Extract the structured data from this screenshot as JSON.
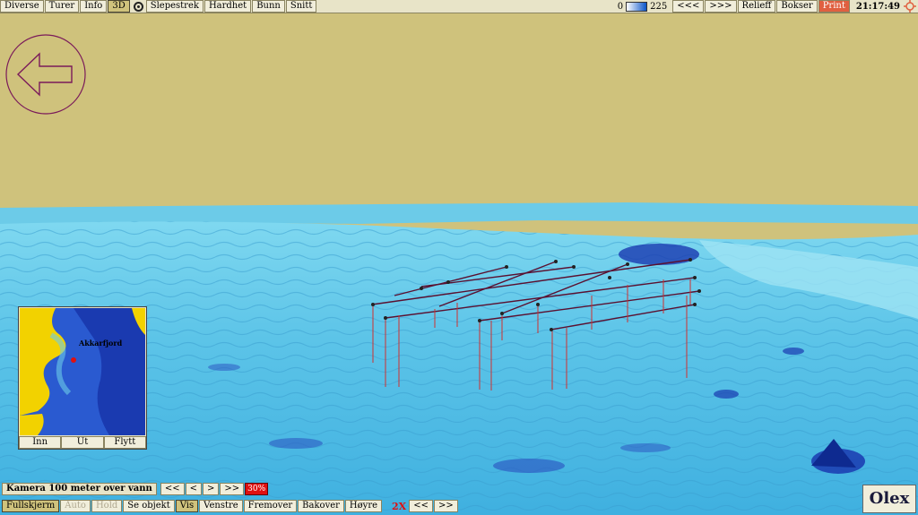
{
  "topbar": {
    "menu": [
      "Diverse",
      "Turer",
      "Info",
      "3D",
      "Slepestrek",
      "Hardhet",
      "Bunn",
      "Snitt"
    ],
    "scale_min": "0",
    "scale_max": "225",
    "prev": "<<<",
    "next": ">>>",
    "relief": "Relieff",
    "boxes": "Bokser",
    "print": "Print",
    "clock": "21:17:49"
  },
  "minimap": {
    "place_label": "Akkarfjord",
    "zoom_in": "Inn",
    "zoom_out": "Ut",
    "move": "Flytt"
  },
  "camera": {
    "label": "Kamera 100 meter over vann",
    "first": "<<",
    "back": "<",
    "forward": ">",
    "last": ">>",
    "percent": "30%"
  },
  "bottombar": {
    "fullscreen": "Fullskjerm",
    "auto": "Auto",
    "hold": "Hold",
    "see_object": "Se objekt",
    "show": "Vis",
    "left": "Venstre",
    "forward": "Fremover",
    "backward": "Bakover",
    "right": "Høyre",
    "speed": "2X",
    "slower": "<<",
    "faster": ">>"
  },
  "logo": "Olex",
  "colors": {
    "land": "#cfc27c",
    "sea": "#5cc4e8",
    "deep": "#1a3ab0",
    "accent": "#e01010"
  },
  "icons": {
    "back": "back-arrow-icon",
    "compass": "compass-icon",
    "locator": "locator-icon"
  }
}
